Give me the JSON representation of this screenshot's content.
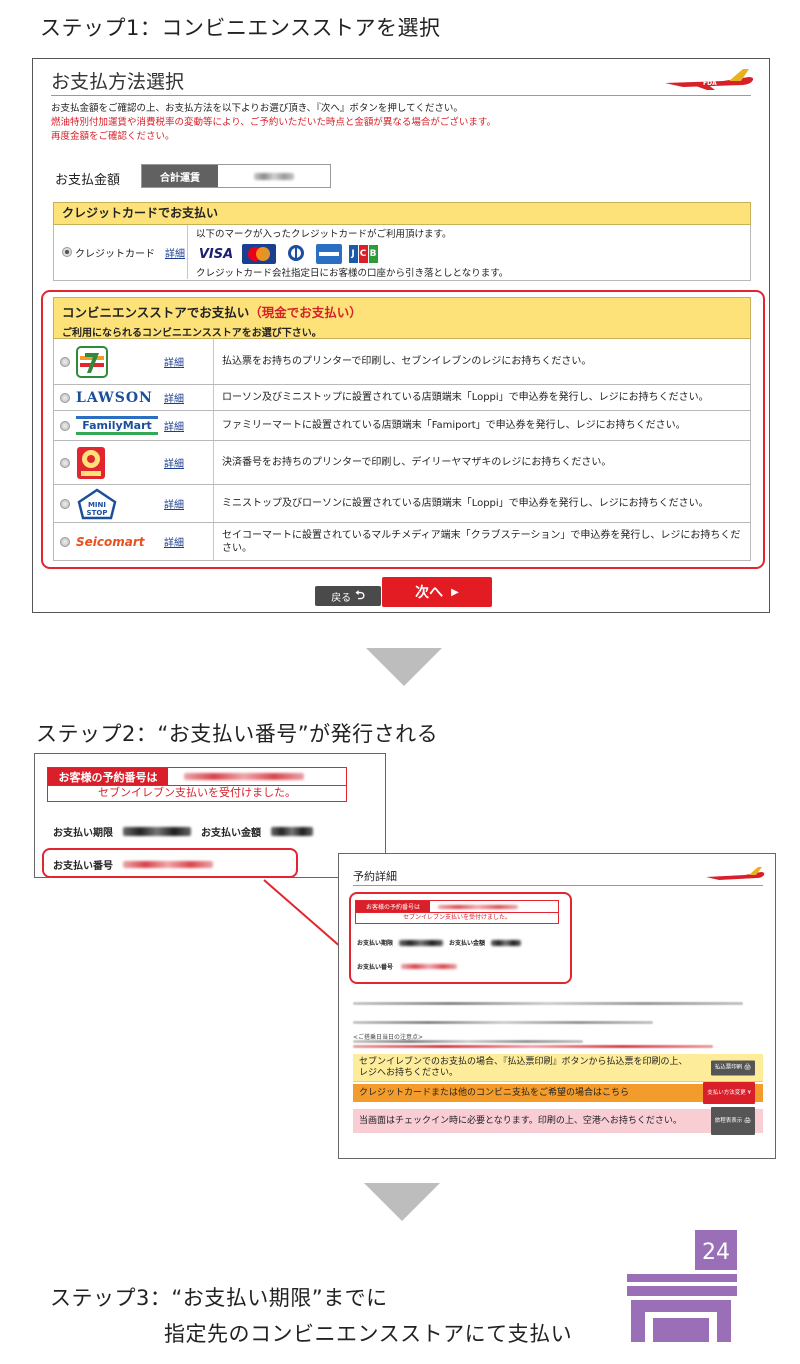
{
  "step1": {
    "title": "ステップ1：コンビニエンスストアを選択",
    "panel_title": "お支払方法選択",
    "brand": "FDA",
    "instruction_1": "お支払金額をご確認の上、お支払方法を以下よりお選び頂き、『次へ』ボタンを押してください。",
    "instruction_2": "燃油特別付加運賃や消費税率の変動等により、ご予約いただいた時点と金額が異なる場合がございます。",
    "instruction_3": "再度金額をご確認ください。",
    "amount_label": "お支払金額",
    "amount_header": "合計運賃",
    "credit": {
      "header": "クレジットカードでお支払い",
      "option_label": "クレジットカード",
      "detail_link": "詳細",
      "note_1": "以下のマークが入ったクレジットカードがご利用頂けます。",
      "note_2": "クレジットカード会社指定日にお客様の口座から引き落としとなります。",
      "brands": [
        "VISA",
        "MasterCard",
        "Diners Club",
        "AMERICAN EXPRESS",
        "JCB"
      ]
    },
    "cvs": {
      "header_main": "コンビニエンスストアでお支払い",
      "header_accent": "（現金でお支払い）",
      "header_sub": "ご利用になられるコンビニエンスストアをお選び下さい。",
      "detail_link": "詳細",
      "stores": [
        {
          "name": "7-Eleven",
          "text": "払込票をお持ちのプリンターで印刷し、セブンイレブンのレジにお持ちください。"
        },
        {
          "name": "LAWSON",
          "text": "ローソン及びミニストップに設置されている店頭端末「Loppi」で申込券を発行し、レジにお持ちください。"
        },
        {
          "name": "FamilyMart",
          "text": "ファミリーマートに設置されている店頭端末「Famiport」で申込券を発行し、レジにお持ちください。"
        },
        {
          "name": "Daily Yamazaki",
          "text": "決済番号をお持ちのプリンターで印刷し、デイリーヤマザキのレジにお持ちください。"
        },
        {
          "name": "MINI STOP",
          "text": "ミニストップ及びローソンに設置されている店頭端末「Loppi」で申込券を発行し、レジにお持ちください。"
        },
        {
          "name": "Seicomart",
          "text": "セイコーマートに設置されているマルチメディア端末「クラブステーション」で申込券を発行し、レジにお持ちください。"
        }
      ]
    },
    "back_label": "戻る",
    "next_label": "次へ"
  },
  "step2": {
    "title": "ステップ2：“お支払い番号”が発行される",
    "reservation_label": "お客様の予約番号は",
    "accepted_text": "セブンイレブン支払いを受付けました。",
    "deadline_label": "お支払い期限",
    "amount_label": "お支払い金額",
    "pay_number_label": "お支払い番号",
    "detail_title": "予約詳細",
    "notes_heading": "<ご搭乗日当日の注意点>",
    "yellow_bar": "セブンイレブンでのお支払の場合、『払込票印刷』ボタンから払込票を印刷の上、レジへお持ちください。",
    "yellow_btn": "払込票印刷",
    "orange_bar": "クレジットカードまたは他のコンビニ支払をご希望の場合はこちら",
    "orange_btn": "支払い方法変更",
    "pink_bar": "当画面はチェックイン時に必要となります。印刷の上、空港へお持ちください。",
    "pink_btn": "旅程表表示"
  },
  "step3": {
    "title_line1": "ステップ3：“お支払い期限”までに",
    "title_line2": "指定先のコンビニエンスストアにて支払い",
    "badge": "24"
  },
  "colors": {
    "accent_red": "#e1262f",
    "header_yellow": "#fde27a",
    "store_purple": "#9a6fb8"
  }
}
